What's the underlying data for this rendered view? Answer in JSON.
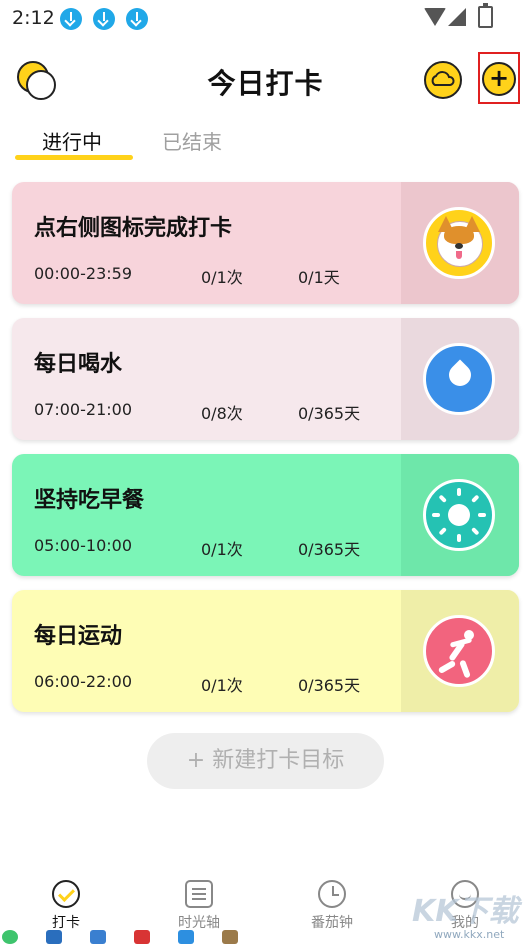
{
  "status_bar": {
    "time": "2:12",
    "download_icons": [
      "download-icon",
      "download-icon",
      "download-icon"
    ],
    "wifi_icon": "wifi-icon",
    "signal_icon": "signal-icon",
    "battery_icon": "battery-charging-icon"
  },
  "header": {
    "title": "今日打卡",
    "logo_icon": "bubbles-logo-icon",
    "cloud_icon": "cloud-icon",
    "add_icon": "plus-icon",
    "add_symbol": "+"
  },
  "tabs": [
    {
      "label": "进行中",
      "active": true
    },
    {
      "label": "已结束",
      "active": false
    }
  ],
  "habits": [
    {
      "name": "点右侧图标完成打卡",
      "time": "00:00-23:59",
      "count": "0/1次",
      "days": "0/1天",
      "icon": "corgi-icon",
      "bg": "#f7d4db",
      "side": "#ecc6cd"
    },
    {
      "name": "每日喝水",
      "time": "07:00-21:00",
      "count": "0/8次",
      "days": "0/365天",
      "icon": "water-drop-icon",
      "bg": "#f6e8ec",
      "side": "#ead9de"
    },
    {
      "name": "坚持吃早餐",
      "time": "05:00-10:00",
      "count": "0/1次",
      "days": "0/365天",
      "icon": "sun-icon",
      "bg": "#7bf5b7",
      "side": "#6ee7aa"
    },
    {
      "name": "每日运动",
      "time": "06:00-22:00",
      "count": "0/1次",
      "days": "0/365天",
      "icon": "running-icon",
      "bg": "#fefdb5",
      "side": "#efeea8"
    }
  ],
  "new_target_button": "+  新建打卡目标",
  "bottom_nav": [
    {
      "label": "打卡",
      "icon": "checkin-icon",
      "active": true
    },
    {
      "label": "时光轴",
      "icon": "timeline-icon",
      "active": false
    },
    {
      "label": "番茄钟",
      "icon": "clock-icon",
      "active": false
    },
    {
      "label": "我的",
      "icon": "profile-icon",
      "active": false
    }
  ],
  "watermark": {
    "big": "KK下载",
    "small": "www.kkx.net"
  },
  "colors": {
    "accent": "#ffd21a",
    "highlight_border": "#e02020"
  }
}
